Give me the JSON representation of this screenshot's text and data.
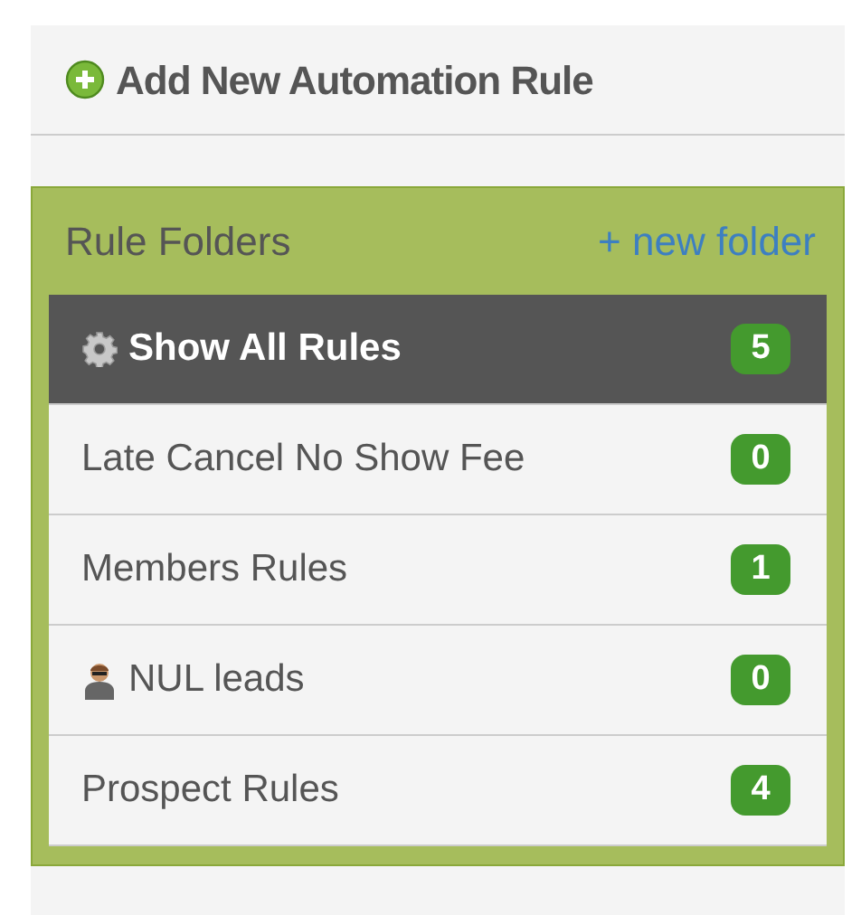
{
  "add_rule": {
    "label": "Add New Automation Rule"
  },
  "folders": {
    "title": "Rule Folders",
    "new_folder": "+ new folder",
    "items": [
      {
        "label": "Show All Rules",
        "count": "5",
        "selected": true,
        "kind": "gear"
      },
      {
        "label": "Late Cancel No Show Fee",
        "count": "0",
        "selected": false,
        "kind": "plain"
      },
      {
        "label": "Members Rules",
        "count": "1",
        "selected": false,
        "kind": "plain"
      },
      {
        "label": "NUL leads",
        "count": "0",
        "selected": false,
        "kind": "person"
      },
      {
        "label": "Prospect Rules",
        "count": "4",
        "selected": false,
        "kind": "plain"
      }
    ]
  }
}
